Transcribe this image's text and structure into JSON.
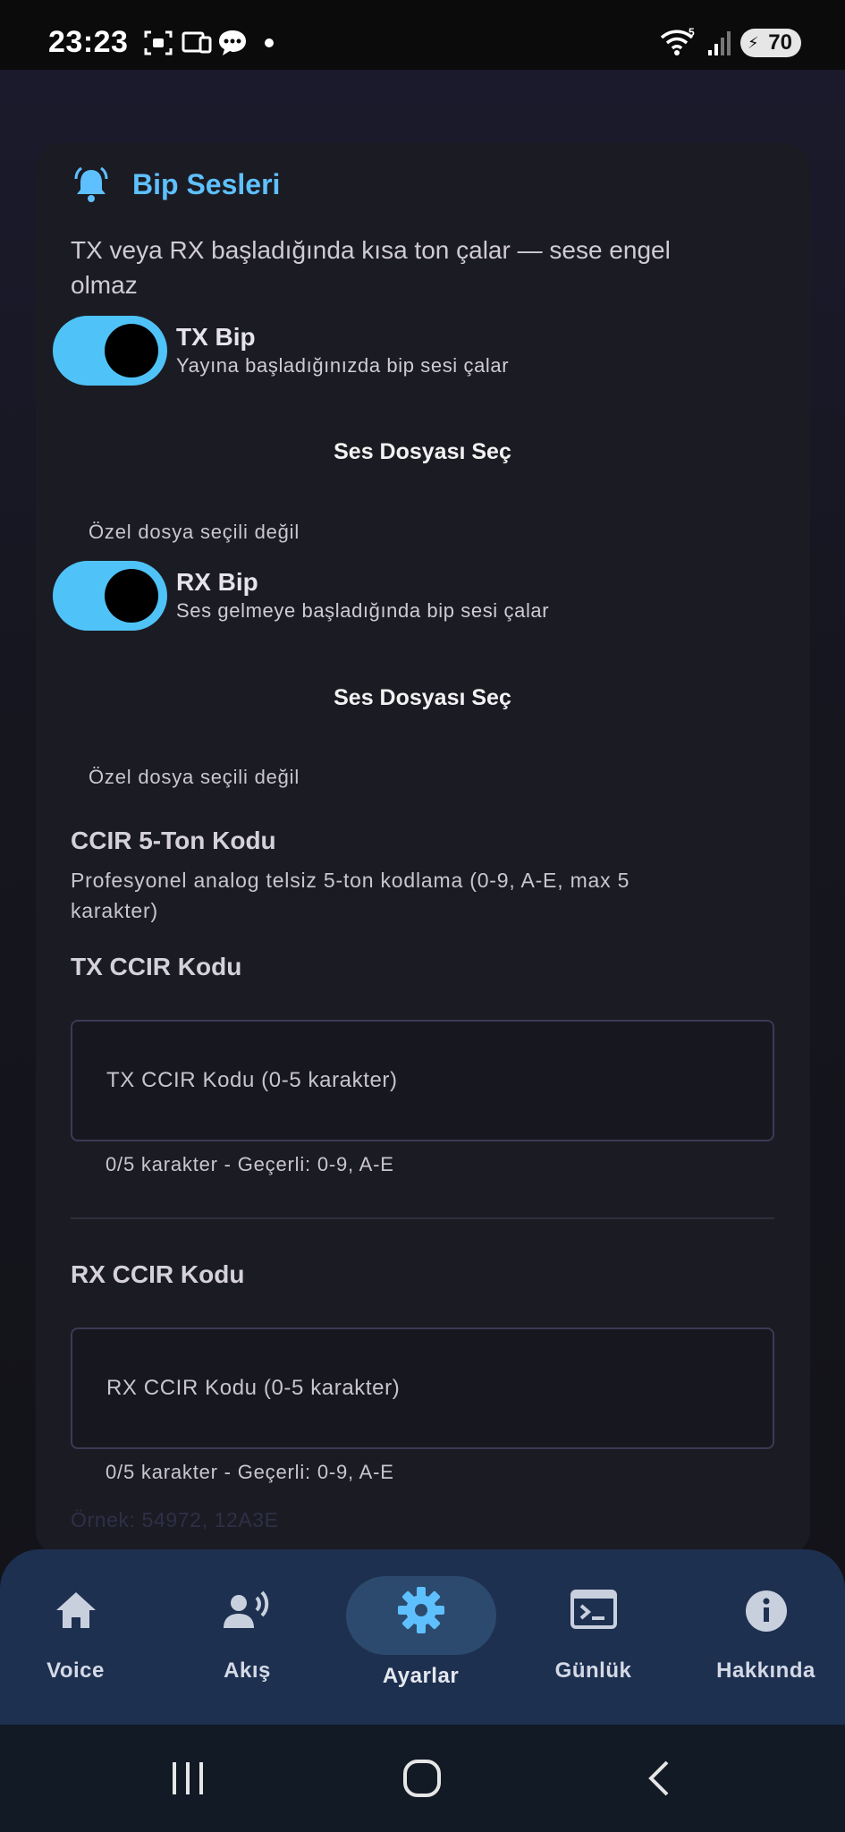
{
  "status_bar": {
    "time": "23:23",
    "battery": "70",
    "icons": [
      "screenshot-icon",
      "cast-icon",
      "chat-icon",
      "dot-icon",
      "wifi-icon",
      "signal-icon"
    ]
  },
  "beep_section": {
    "title": "Bip Sesleri",
    "description_line1": "TX veya RX başladığında kısa ton çalar — sese engel",
    "description_line2": "olmaz",
    "tx": {
      "title": "TX Bip",
      "subtitle": "Yayına başladığınızda bip sesi çalar",
      "enabled": true,
      "file_button": "Ses Dosyası Seç",
      "file_status": "Özel dosya seçili değil"
    },
    "rx": {
      "title": "RX Bip",
      "subtitle": "Ses gelmeye başladığında bip sesi çalar",
      "enabled": true,
      "file_button": "Ses Dosyası Seç",
      "file_status": "Özel dosya seçili değil"
    }
  },
  "ccir_section": {
    "title": "CCIR 5-Ton Kodu",
    "description_line1": "Profesyonel analog telsiz 5-ton kodlama (0-9, A-E, max 5",
    "description_line2": "karakter)",
    "tx": {
      "heading": "TX CCIR Kodu",
      "placeholder": "TX CCIR Kodu (0-5 karakter)",
      "helper": "0/5 karakter - Geçerli: 0-9, A-E"
    },
    "rx": {
      "heading": "RX CCIR Kodu",
      "placeholder": "RX CCIR Kodu (0-5 karakter)",
      "helper": "0/5 karakter - Geçerli: 0-9, A-E"
    },
    "example": "Örnek: 54972, 12A3E"
  },
  "bottom_nav": {
    "items": [
      {
        "label": "Voice",
        "icon": "home-icon"
      },
      {
        "label": "Akış",
        "icon": "person-voice-icon"
      },
      {
        "label": "Ayarlar",
        "icon": "gear-icon",
        "active": true
      },
      {
        "label": "Günlük",
        "icon": "terminal-icon"
      },
      {
        "label": "Hakkında",
        "icon": "info-icon"
      }
    ]
  },
  "system_nav": [
    "recents-button",
    "home-button",
    "back-button"
  ],
  "colors": {
    "accent": "#4fc3f7",
    "title_blue": "#5ec0ff",
    "nav_bg": "#1e3050",
    "card_bg": "#1b1b23"
  }
}
